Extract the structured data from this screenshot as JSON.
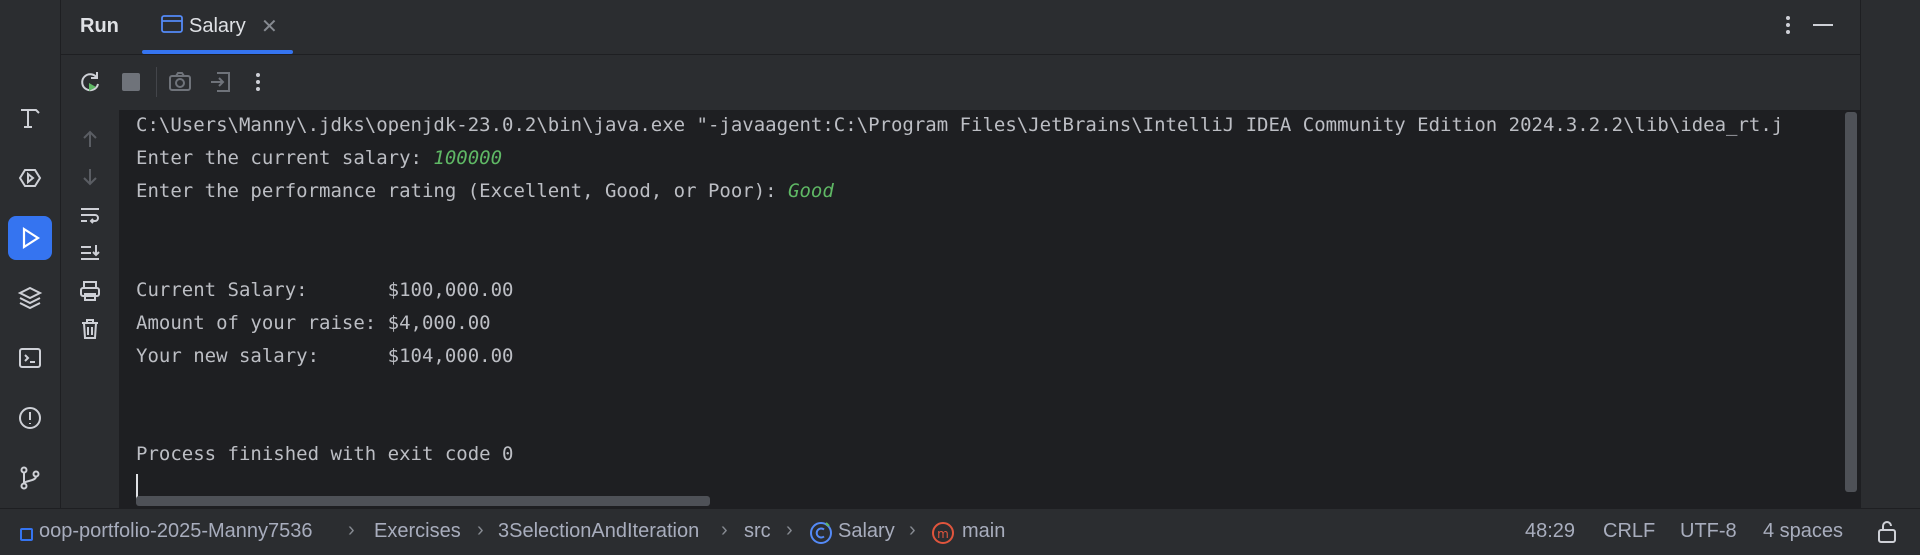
{
  "header": {
    "run_title": "Run",
    "tab_label": "Salary"
  },
  "console": {
    "lines": [
      "C:\\Users\\Manny\\.jdks\\openjdk-23.0.2\\bin\\java.exe \"-javaagent:C:\\Program Files\\JetBrains\\IntelliJ IDEA Community Edition 2024.3.2.2\\lib\\idea_rt.j",
      "Enter the current salary: ",
      "100000",
      "Enter the performance rating (Excellent, Good, or Poor): ",
      "Good",
      "Current Salary:       $100,000.00",
      "Amount of your raise: $4,000.00",
      "Your new salary:      $104,000.00",
      "Process finished with exit code 0"
    ]
  },
  "status": {
    "breadcrumbs": [
      "oop-portfolio-2025-Manny7536",
      "Exercises",
      "3SelectionAndIteration",
      "src",
      "Salary",
      "main"
    ],
    "position": "48:29",
    "line_sep": "CRLF",
    "encoding": "UTF-8",
    "indent": "4 spaces"
  },
  "colors": {
    "accent": "#3574f0",
    "input_text": "#5fb865",
    "console_bg": "#1e1f22",
    "panel_bg": "#2b2d30"
  }
}
